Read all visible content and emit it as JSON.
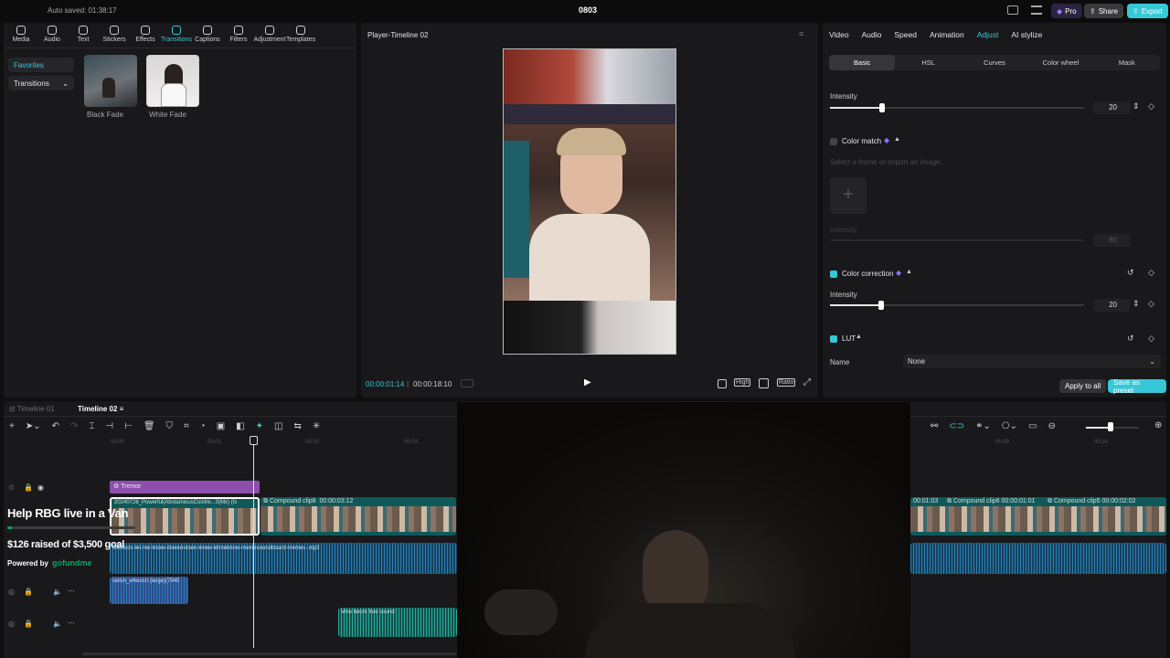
{
  "topbar": {
    "autosave": "Auto saved: 01:38:17",
    "project": "0803",
    "pro": "Pro",
    "share": "Share",
    "export": "Export"
  },
  "toolbar": [
    {
      "label": "Media",
      "icon": "media-icon"
    },
    {
      "label": "Audio",
      "icon": "audio-icon"
    },
    {
      "label": "Text",
      "icon": "text-icon"
    },
    {
      "label": "Stickers",
      "icon": "stickers-icon"
    },
    {
      "label": "Effects",
      "icon": "effects-icon"
    },
    {
      "label": "Transitions",
      "icon": "transitions-icon"
    },
    {
      "label": "Captions",
      "icon": "captions-icon"
    },
    {
      "label": "Filters",
      "icon": "filters-icon"
    },
    {
      "label": "Adjustment",
      "icon": "adjustment-icon"
    },
    {
      "label": "Templates",
      "icon": "templates-icon"
    }
  ],
  "library": {
    "favorites": "Favorites",
    "transitions": "Transitions",
    "items": [
      "Black Fade",
      "White Fade"
    ]
  },
  "player": {
    "title": "Player-Timeline 02",
    "current": "00:00:01:14",
    "total": "00:00:18:10",
    "quality": "High",
    "ratio": "Ratio"
  },
  "inspector": {
    "tabs": [
      "Video",
      "Audio",
      "Speed",
      "Animation",
      "Adjust",
      "AI stylize"
    ],
    "subtabs": [
      "Basic",
      "HSL",
      "Curves",
      "Color wheel",
      "Mask"
    ],
    "intensity_label": "Intensity",
    "intensity1": "20",
    "color_match": "Color match",
    "color_match_hint": "Select a frame or import an image.",
    "intensity_dim": "Intensity",
    "intensity_dim_val": "80",
    "color_correction": "Color correction",
    "intensity2": "20",
    "lut": "LUT",
    "name_label": "Name",
    "name_value": "None",
    "apply_all": "Apply to all",
    "save_preset": "Save as preset"
  },
  "timeline": {
    "tabs": [
      "Timeline 01",
      "Timeline 02"
    ],
    "ruler": [
      "00:00",
      "00:01",
      "00:02",
      "00:03",
      "00:09",
      "00:10"
    ],
    "effect_clip": "Tremor",
    "video_clip": "20240728_Powerful(AbstamiousCoistre...0(Mx) (Is",
    "compound1_name": "Compound clip8",
    "compound1_time": "00:00:03:12",
    "right_time": "00:01:03",
    "compound2_name": "Compound clip6",
    "compound2_time": "00:00:01:01",
    "compound3_name": "Compound clip5",
    "compound3_time": "00:00:02:02",
    "audio_main": "iontrects-let-me-know-dowed-doen-know-letmeknow-memesoundboard-memes-.mp3",
    "audio_swish": "swish_whoosh (large)(7945",
    "audio_vine": "Vine boom free sound",
    "cover": "Cover"
  },
  "overlay": {
    "title": "Help RBG live in a Van",
    "raised": "$126 raised of $3,500 goal",
    "powered": "Powered by",
    "brand": "gofundme",
    "progress": 0.036
  },
  "colors": {
    "accent": "#36c8d6",
    "purple": "#8d4fae",
    "bg": "#19191b"
  }
}
